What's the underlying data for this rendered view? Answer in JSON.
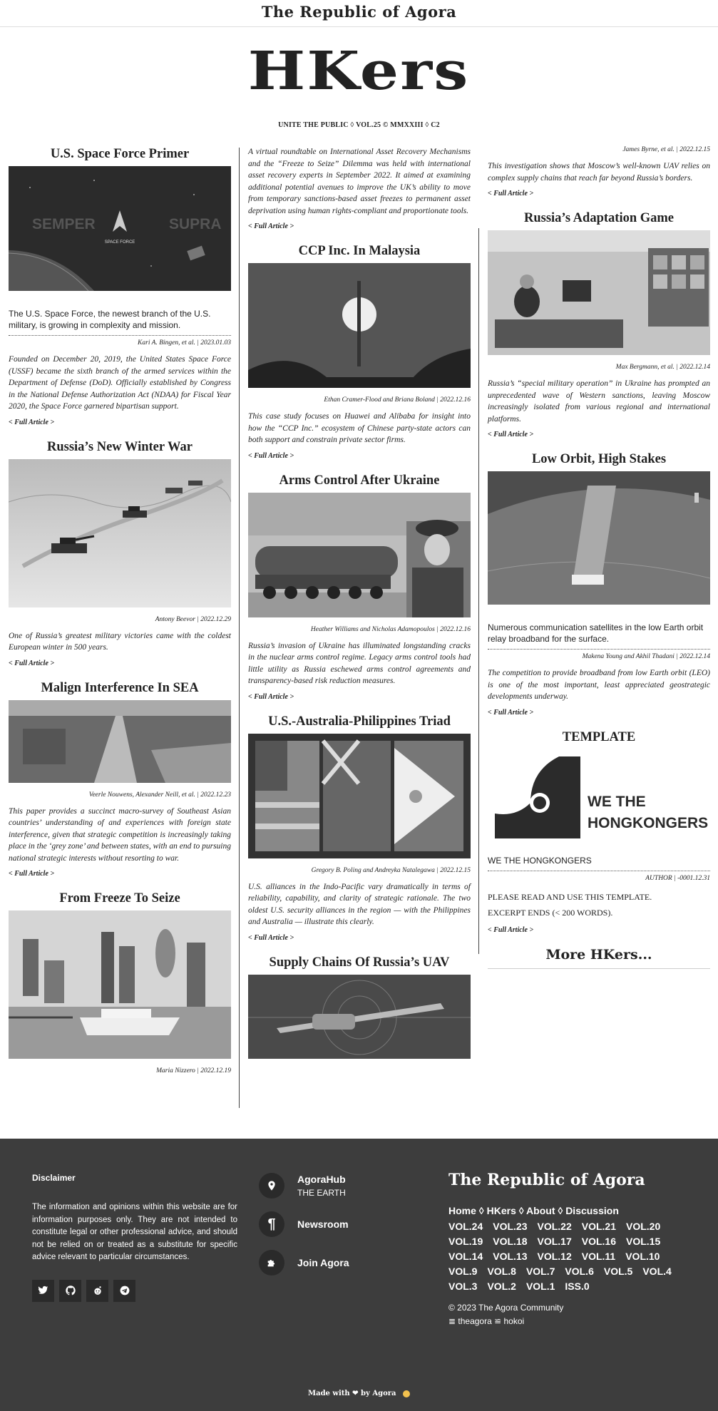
{
  "header": {
    "site_title": "The Republic of Agora",
    "logo": "HKers",
    "edition": "UNITE THE PUBLIC ◊ VOL.25 © MMXXIII ◊ C2"
  },
  "articles": {
    "space_force": {
      "title": "U.S. Space Force Primer",
      "summary": "The U.S. Space Force, the newest branch of the U.S. military, is growing in complexity and mission.",
      "byline": "Kari A. Bingen, et al. | 2023.01.03",
      "excerpt": "Founded on December 20, 2019, the United States Space Force (USSF) became the sixth branch of the armed services within the Department of Defense (DoD). Officially established by Congress in the National Defense Authorization Act (NDAA) for Fiscal Year 2020, the Space Force garnered bipartisan support.",
      "link": "< Full Article >",
      "img_text_left": "SEMPER",
      "img_text_right": "SUPRA",
      "img_badge": "SPACE FORCE"
    },
    "winter_war": {
      "title": "Russia’s New Winter War",
      "byline": "Antony Beevor | 2022.12.29",
      "excerpt": "One of Russia’s greatest military victories came with the coldest European winter in 500 years.",
      "link": "< Full Article >"
    },
    "malign": {
      "title": "Malign Interference In SEA",
      "byline": "Veerle Nouwens, Alexander Neill, et al. | 2022.12.23",
      "excerpt": "This paper provides a succinct macro-survey of Southeast Asian countries’ understanding of and experiences with foreign state interference, given that strategic competition is increasingly taking place in the ‘grey zone’ and between states, with an end to pursuing national strategic interests without resorting to war.",
      "link": "< Full Article >"
    },
    "freeze": {
      "title": "From Freeze To Seize",
      "byline": "Maria Nizzero | 2022.12.19",
      "excerpt": "A virtual roundtable on International Asset Recovery Mechanisms and the “Freeze to Seize” Dilemma was held with international asset recovery experts in September 2022. It aimed at examining additional potential avenues to improve the UK’s ability to move from temporary sanctions-based asset freezes to permanent asset deprivation using human rights-compliant and proportionate tools.",
      "link": "< Full Article >"
    },
    "ccp": {
      "title": "CCP Inc. In Malaysia",
      "byline": "Ethan Cramer-Flood and Briana Boland | 2022.12.16",
      "excerpt": "This case study focuses on Huawei and Alibaba for insight into how the “CCP Inc.” ecosystem of Chinese party-state actors can both support and constrain private sector firms.",
      "link": "< Full Article >"
    },
    "arms": {
      "title": "Arms Control After Ukraine",
      "byline": "Heather Williams and Nicholas Adamopoulos | 2022.12.16",
      "excerpt": "Russia’s invasion of Ukraine has illuminated longstanding cracks in the nuclear arms control regime. Legacy arms control tools had little utility as Russia eschewed arms control agreements and transparency-based risk reduction measures.",
      "link": "< Full Article >"
    },
    "triad": {
      "title": "U.S.-Australia-Philippines Triad",
      "byline": "Gregory B. Poling and Andreyka Natalegawa | 2022.12.15",
      "excerpt": "U.S. alliances in the Indo-Pacific vary dramatically in terms of reliability, capability, and clarity of strategic rationale. The two oldest U.S. security alliances in the region — with the Philippines and Australia — illustrate this clearly.",
      "link": "< Full Article >"
    },
    "uav": {
      "title": "Supply Chains Of Russia’s UAV",
      "byline": "James Byrne, et al. | 2022.12.15",
      "excerpt": "This investigation shows that Moscow’s well-known UAV relies on complex supply chains that reach far beyond Russia’s borders.",
      "link": "< Full Article >"
    },
    "adaptation": {
      "title": "Russia’s Adaptation Game",
      "byline": "Max Bergmann, et al. | 2022.12.14",
      "excerpt": "Russia’s “special military operation” in Ukraine has prompted an unprecedented wave of Western sanctions, leaving Moscow increasingly isolated from various regional and international platforms.",
      "link": "< Full Article >"
    },
    "orbit": {
      "title": "Low Orbit, High Stakes",
      "summary": "Numerous communication satellites in the low Earth orbit relay broadband for the surface.",
      "byline": "Makena Young and Akhil Thadani | 2022.12.14",
      "excerpt": "The competition to provide broadband from low Earth orbit (LEO) is one of the most important, least appreciated geostrategic developments underway.",
      "link": "< Full Article >"
    },
    "template": {
      "title": "TEMPLATE",
      "img_text": "WE THE HONGKONGERS",
      "summary": "WE THE HONGKONGERS",
      "byline": "AUTHOR | -0001.12.31",
      "line1": "PLEASE READ AND USE THIS TEMPLATE.",
      "line2": "EXCERPT ENDS (< 200 WORDS).",
      "link": "< Full Article >"
    }
  },
  "more_label": "More HKers...",
  "footer": {
    "disclaimer_title": "Disclaimer",
    "disclaimer_text": "The information and opinions within this website are for information purposes only. They are not intended to constitute legal or other professional advice, and should not be relied on or treated as a substitute for specific advice relevant to particular circumstances.",
    "socials": [
      "twitter-icon",
      "github-icon",
      "reddit-icon",
      "telegram-icon"
    ],
    "hub_title": "AgoraHub",
    "hub_sub": "THE EARTH",
    "newsroom": "Newsroom",
    "join": "Join Agora",
    "brand": "The Republic of Agora",
    "nav": [
      "Home",
      "HKers",
      "About",
      "Discussion"
    ],
    "nav_sep": " ◊ ",
    "vols": [
      "VOL.24",
      "VOL.23",
      "VOL.22",
      "VOL.21",
      "VOL.20",
      "VOL.19",
      "VOL.18",
      "VOL.17",
      "VOL.16",
      "VOL.15",
      "VOL.14",
      "VOL.13",
      "VOL.12",
      "VOL.11",
      "VOL.10",
      "VOL.9",
      "VOL.8",
      "VOL.7",
      "VOL.6",
      "VOL.5",
      "VOL.4",
      "VOL.3",
      "VOL.2",
      "VOL.1",
      "ISS.0"
    ],
    "copyright": "© 2023 The Agora Community",
    "links": "≣ theagora ≌ hokoi",
    "made": "Made with ❤ by Agora"
  }
}
